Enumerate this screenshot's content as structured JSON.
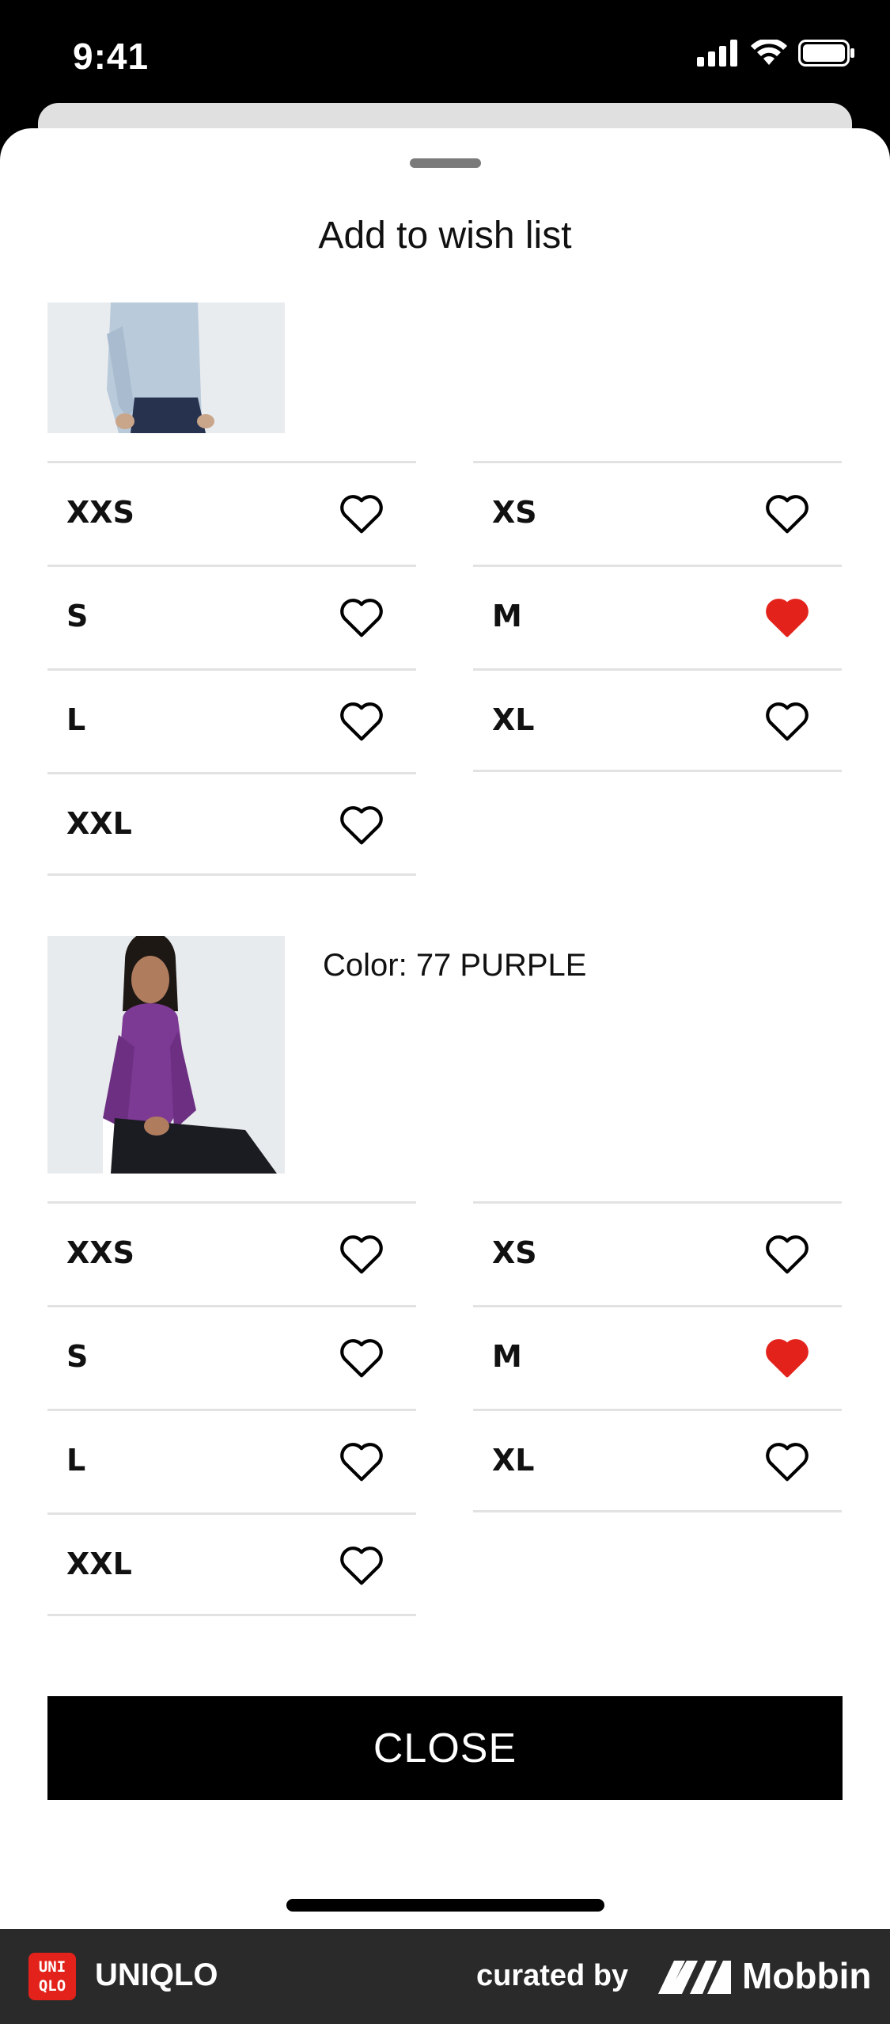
{
  "status_bar": {
    "time": "9:41"
  },
  "sheet": {
    "title": "Add to wish list"
  },
  "products": [
    {
      "color_label": "",
      "sizes": [
        {
          "label": "XXS",
          "wished": false
        },
        {
          "label": "XS",
          "wished": false
        },
        {
          "label": "S",
          "wished": false
        },
        {
          "label": "M",
          "wished": true
        },
        {
          "label": "L",
          "wished": false
        },
        {
          "label": "XL",
          "wished": false
        },
        {
          "label": "XXL",
          "wished": false
        }
      ]
    },
    {
      "color_label": "Color: 77 PURPLE",
      "sizes": [
        {
          "label": "XXS",
          "wished": false
        },
        {
          "label": "XS",
          "wished": false
        },
        {
          "label": "S",
          "wished": false
        },
        {
          "label": "M",
          "wished": true
        },
        {
          "label": "L",
          "wished": false
        },
        {
          "label": "XL",
          "wished": false
        },
        {
          "label": "XXL",
          "wished": false
        }
      ]
    }
  ],
  "close_label": "CLOSE",
  "footer": {
    "logo_text": "UNI QLO",
    "brand": "UNIQLO",
    "curated_by": "curated by",
    "mobbin": "Mobbin"
  },
  "colors": {
    "heart_active": "#e3231b",
    "button": "#000000"
  },
  "icons": {
    "heart_empty": "heart-outline-icon",
    "heart_full": "heart-filled-icon"
  }
}
